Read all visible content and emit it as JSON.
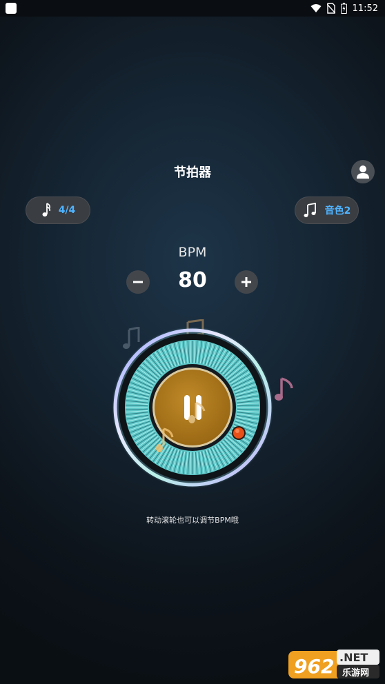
{
  "status_bar": {
    "time": "11:52",
    "icons": [
      "app-icon",
      "wifi-icon",
      "no-sim-icon",
      "battery-icon"
    ]
  },
  "header": {
    "title": "节拍器",
    "profile_icon": "person-icon"
  },
  "controls": {
    "time_signature": "4/4",
    "time_signature_icon": "music-note-icon",
    "tone": "音色2",
    "tone_icon": "music-notes-icon"
  },
  "bpm": {
    "label": "BPM",
    "value": "80",
    "decrease_icon": "minus-icon",
    "increase_icon": "plus-icon"
  },
  "dial": {
    "state_icon": "pause-icon",
    "hint": "转动滚轮也可以调节BPM哦"
  },
  "watermark": {
    "brand": "962.NET",
    "sub": "乐游网"
  },
  "colors": {
    "accent_blue": "#4fb3ff",
    "dial_center": "#b07a1c",
    "dial_teal": "#5fc8c8",
    "knob_orange": "#e8501a"
  }
}
